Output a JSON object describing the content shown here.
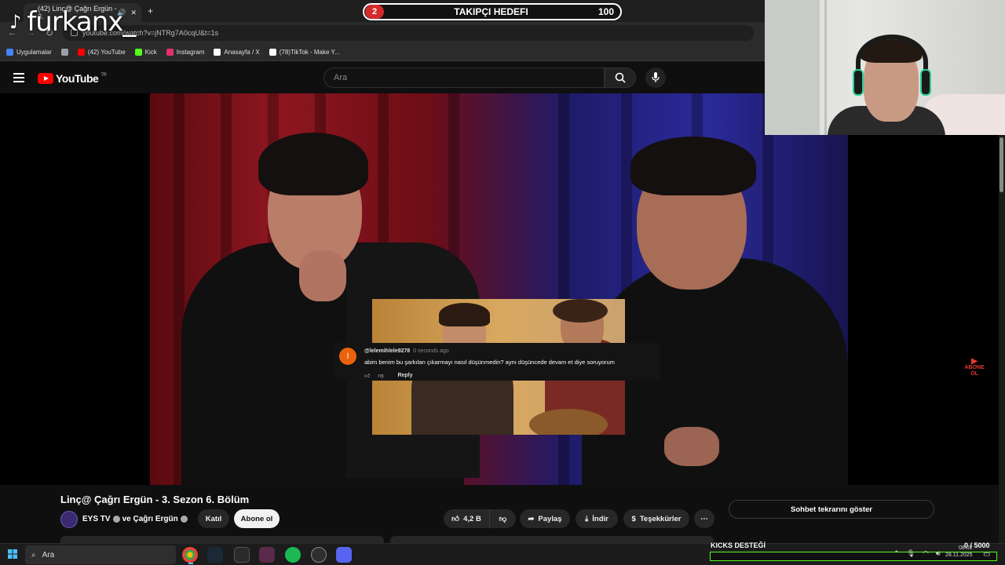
{
  "browser": {
    "tab_title": "(42) Linç@ Çağrı Ergün - 3.",
    "new_tab": "+",
    "url": "youtube.com/watch?v=jNTRg7A0cqU&t=1s",
    "bookmarks": [
      {
        "label": "Uygulamalar",
        "color": "#4285f4"
      },
      {
        "label": "",
        "color": "#9aa0a6"
      },
      {
        "label": "(42) YouTube",
        "color": "#ff0000"
      },
      {
        "label": "Kick",
        "color": "#53fc18"
      },
      {
        "label": "Instagram",
        "color": "#e1306c"
      },
      {
        "label": "Anasayfa / X",
        "color": "#ffffff"
      },
      {
        "label": "(78)TikTok - Make Y...",
        "color": "#ffffff"
      }
    ]
  },
  "overlay": {
    "brand": "furkanx_",
    "goal_label": "TAKIPÇI HEDEFI",
    "goal_current": "2",
    "goal_target": "100",
    "kicks_label": "KICKS DESTEĞİ",
    "kicks_count": "0 / 5000",
    "kicks_progress": 0
  },
  "youtube": {
    "logo_text": "YouTube",
    "region": "TR",
    "search_placeholder": "Ara",
    "video_title": "Linç@ Çağrı Ergün - 3. Sezon 6. Bölüm",
    "channel": "EYS TV",
    "channel_collab": "ve Çağrı Ergün",
    "join": "Katıl",
    "subscribe": "Abone ol",
    "likes": "4,2 B",
    "share": "Paylaş",
    "download": "İndir",
    "thanks": "Teşekkürler",
    "chat_replay": "Sohbet tekrarını göster"
  },
  "comment": {
    "avatar_letter": "l",
    "user": "@lelemihlele9278",
    "time": "0 seconds ago",
    "text": "abim benim bu şarkıları çıkarmayı nasıl düşünmedin? aynı düşüncede devam et diye soruyorum",
    "reply": "Reply"
  },
  "watermark": {
    "line1": "ABONE",
    "line2": "OL"
  },
  "taskbar": {
    "search_placeholder": "Ara",
    "time": "08:02",
    "date": "28.11.2025",
    "apps": [
      {
        "name": "chrome-icon",
        "color": "#4285f4"
      },
      {
        "name": "steam-icon",
        "color": "#1b2838"
      },
      {
        "name": "epic-games-icon",
        "color": "#2a2a2a"
      },
      {
        "name": "app-icon",
        "color": "#5a2a4a"
      },
      {
        "name": "spotify-icon",
        "color": "#1db954"
      },
      {
        "name": "obs-icon",
        "color": "#302e31"
      },
      {
        "name": "discord-icon",
        "color": "#5865f2"
      }
    ]
  }
}
